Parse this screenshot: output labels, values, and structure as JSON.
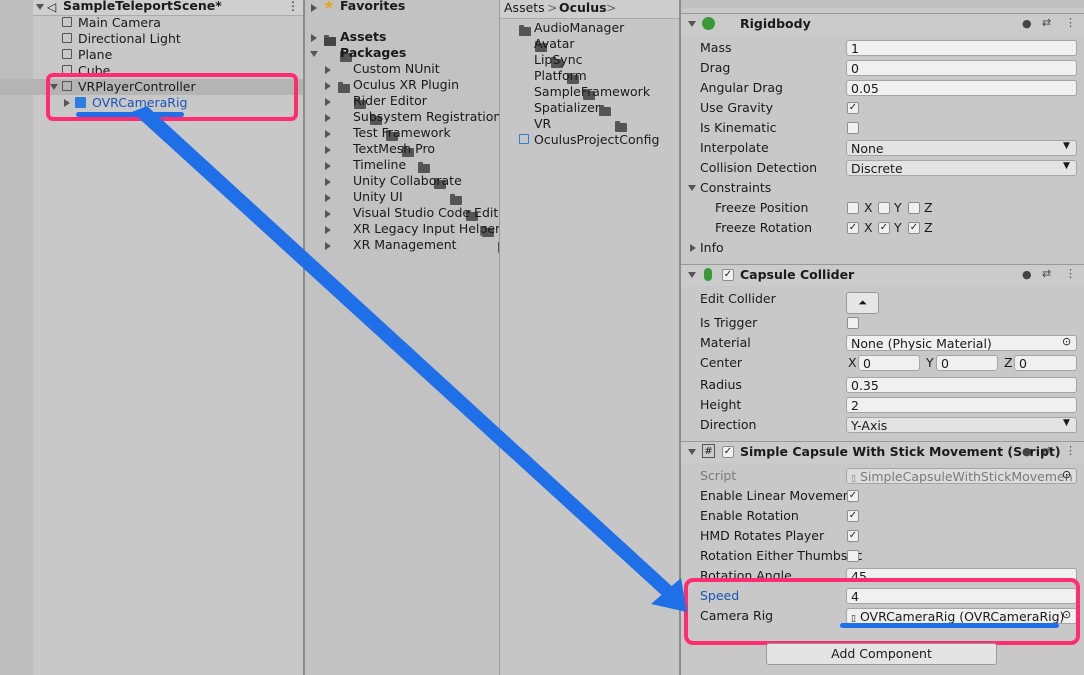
{
  "hierarchy": {
    "scene_name": "SampleTeleportScene*",
    "items": [
      {
        "label": "Main Camera"
      },
      {
        "label": "Directional Light"
      },
      {
        "label": "Plane"
      },
      {
        "label": "Cube"
      },
      {
        "label": "VRPlayerController"
      },
      {
        "label": "OVRCameraRig"
      }
    ]
  },
  "project": {
    "favorites": "Favorites",
    "assets": "Assets",
    "packages": "Packages",
    "package_items": [
      "Custom NUnit",
      "Oculus XR Plugin",
      "Rider Editor",
      "Subsystem Registration",
      "Test Framework",
      "TextMesh Pro",
      "Timeline",
      "Unity Collaborate",
      "Unity UI",
      "Visual Studio Code Editor",
      "XR Legacy Input Helpers",
      "XR Management"
    ]
  },
  "breadcrumb": {
    "root": "Assets",
    "current": "Oculus"
  },
  "folder_contents": [
    "AudioManager",
    "Avatar",
    "LipSync",
    "Platform",
    "SampleFramework",
    "Spatializer",
    "VR",
    "OculusProjectConfig"
  ],
  "inspector": {
    "rigidbody": {
      "title": "Rigidbody",
      "mass_label": "Mass",
      "mass": "1",
      "drag_label": "Drag",
      "drag": "0",
      "angular_drag_label": "Angular Drag",
      "angular_drag": "0.05",
      "use_gravity_label": "Use Gravity",
      "is_kinematic_label": "Is Kinematic",
      "interpolate_label": "Interpolate",
      "interpolate": "None",
      "collision_label": "Collision Detection",
      "collision": "Discrete",
      "constraints_label": "Constraints",
      "freeze_pos_label": "Freeze Position",
      "freeze_rot_label": "Freeze Rotation",
      "info_label": "Info",
      "x": "X",
      "y": "Y",
      "z": "Z"
    },
    "capsule": {
      "title": "Capsule Collider",
      "edit_label": "Edit Collider",
      "trigger_label": "Is Trigger",
      "material_label": "Material",
      "material": "None (Physic Material)",
      "center_label": "Center",
      "cx": "0",
      "cy": "0",
      "cz": "0",
      "radius_label": "Radius",
      "radius": "0.35",
      "height_label": "Height",
      "height": "2",
      "direction_label": "Direction",
      "direction": "Y-Axis"
    },
    "script": {
      "title": "Simple Capsule With Stick Movement (Script)",
      "script_label": "Script",
      "script_value": "SimpleCapsuleWithStickMovemen",
      "linear_label": "Enable Linear Movement",
      "rotation_label": "Enable Rotation",
      "hmd_label": "HMD Rotates Player",
      "either_label": "Rotation Either Thumbstic",
      "angle_label": "Rotation Angle",
      "angle": "45",
      "speed_label": "Speed",
      "speed": "4",
      "camrig_label": "Camera Rig",
      "camrig": "OVRCameraRig (OVRCameraRig)"
    },
    "add_component": "Add Component"
  },
  "colors": {
    "highlight": "#ff2d6f",
    "arrow": "#1e6fe8",
    "link": "#1a55b8"
  }
}
